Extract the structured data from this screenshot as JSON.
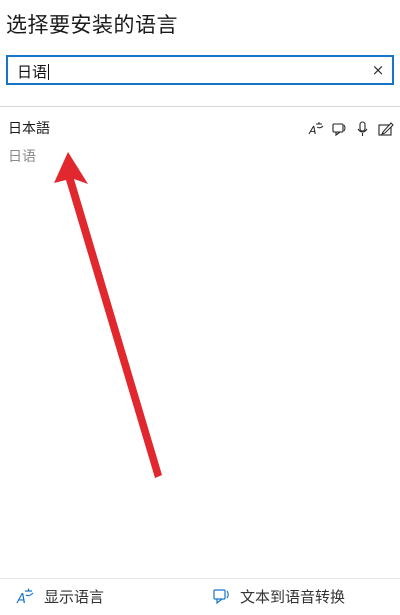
{
  "page": {
    "title": "选择要安装的语言"
  },
  "search": {
    "value": "日语",
    "clear_label": "×"
  },
  "results": [
    {
      "name": "日本語",
      "subtitle": "日语",
      "features": [
        "display-language-icon",
        "text-to-speech-icon",
        "speech-recognition-icon",
        "handwriting-icon"
      ]
    }
  ],
  "legend": {
    "display_language": "显示语言",
    "text_to_speech": "文本到语音转换"
  },
  "colors": {
    "accent": "#1874c7",
    "annotation_arrow": "#e0282e"
  }
}
